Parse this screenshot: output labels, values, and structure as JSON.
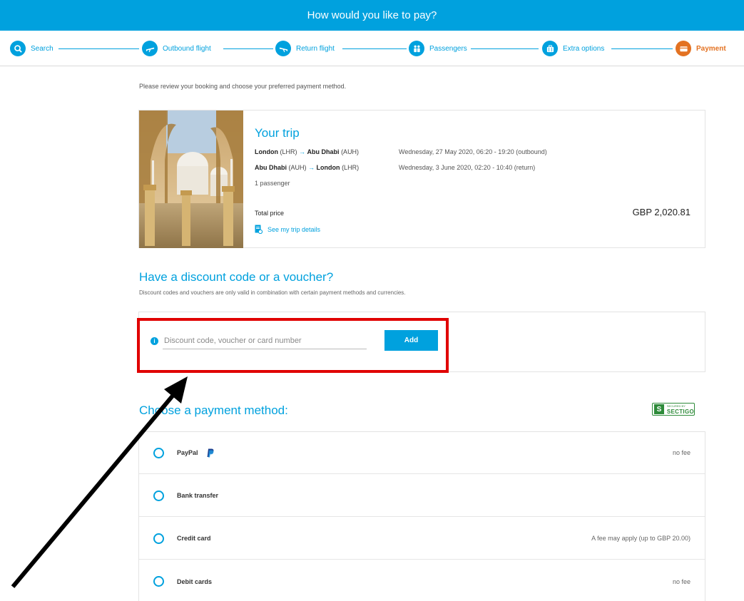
{
  "header": {
    "title": "How would you like to pay?"
  },
  "steps": [
    {
      "label": "Search",
      "icon": "search-icon"
    },
    {
      "label": "Outbound flight",
      "icon": "plane-outbound-icon"
    },
    {
      "label": "Return flight",
      "icon": "plane-return-icon"
    },
    {
      "label": "Passengers",
      "icon": "passengers-icon"
    },
    {
      "label": "Extra options",
      "icon": "luggage-icon"
    },
    {
      "label": "Payment",
      "icon": "card-icon",
      "active": true
    }
  ],
  "intro": "Please review your booking and choose your preferred payment method.",
  "trip": {
    "title": "Your trip",
    "segments": [
      {
        "from": "London",
        "from_code": "(LHR)",
        "to": "Abu Dhabi",
        "to_code": "(AUH)",
        "date": "Wednesday, 27 May 2020, 06:20 - 19:20 (outbound)"
      },
      {
        "from": "Abu Dhabi",
        "from_code": "(AUH)",
        "to": "London",
        "to_code": "(LHR)",
        "date": "Wednesday, 3 June 2020, 02:20 - 10:40 (return)"
      }
    ],
    "passengers": "1 passenger",
    "total_label": "Total price",
    "total_price": "GBP 2,020.81",
    "details_link": "See my trip details"
  },
  "discount": {
    "title": "Have a discount code or a voucher?",
    "subtitle": "Discount codes and vouchers are only valid in combination with certain payment methods and currencies.",
    "placeholder": "Discount code, voucher or card number",
    "add_label": "Add"
  },
  "payment": {
    "title": "Choose a payment method:",
    "secured_small": "SECURED BY",
    "secured_brand": "SECTIGO",
    "methods": [
      {
        "label": "PayPal",
        "fee": "no fee"
      },
      {
        "label": "Bank transfer",
        "fee": ""
      },
      {
        "label": "Credit card",
        "fee": "A fee may apply (up to GBP 20.00)"
      },
      {
        "label": "Debit cards",
        "fee": "no fee"
      }
    ]
  },
  "colors": {
    "accent": "#00a1de",
    "active_step": "#e37222",
    "highlight": "#e00000",
    "secure": "#2e8b3a"
  }
}
